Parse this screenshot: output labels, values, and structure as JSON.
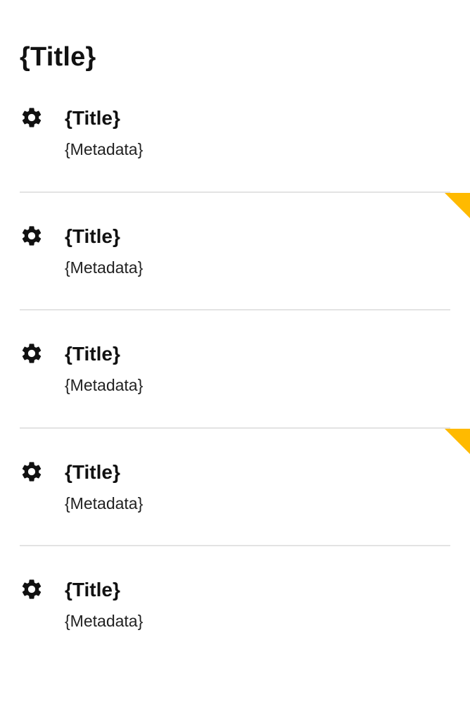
{
  "page": {
    "title": "{Title}"
  },
  "accent_color": "#ffba00",
  "items": [
    {
      "icon": "gear-icon",
      "title": "{Title}",
      "metadata": "{Metadata}",
      "flagged": false
    },
    {
      "icon": "gear-icon",
      "title": "{Title}",
      "metadata": "{Metadata}",
      "flagged": true
    },
    {
      "icon": "gear-icon",
      "title": "{Title}",
      "metadata": "{Metadata}",
      "flagged": false
    },
    {
      "icon": "gear-icon",
      "title": "{Title}",
      "metadata": "{Metadata}",
      "flagged": true
    },
    {
      "icon": "gear-icon",
      "title": "{Title}",
      "metadata": "{Metadata}",
      "flagged": false
    }
  ]
}
